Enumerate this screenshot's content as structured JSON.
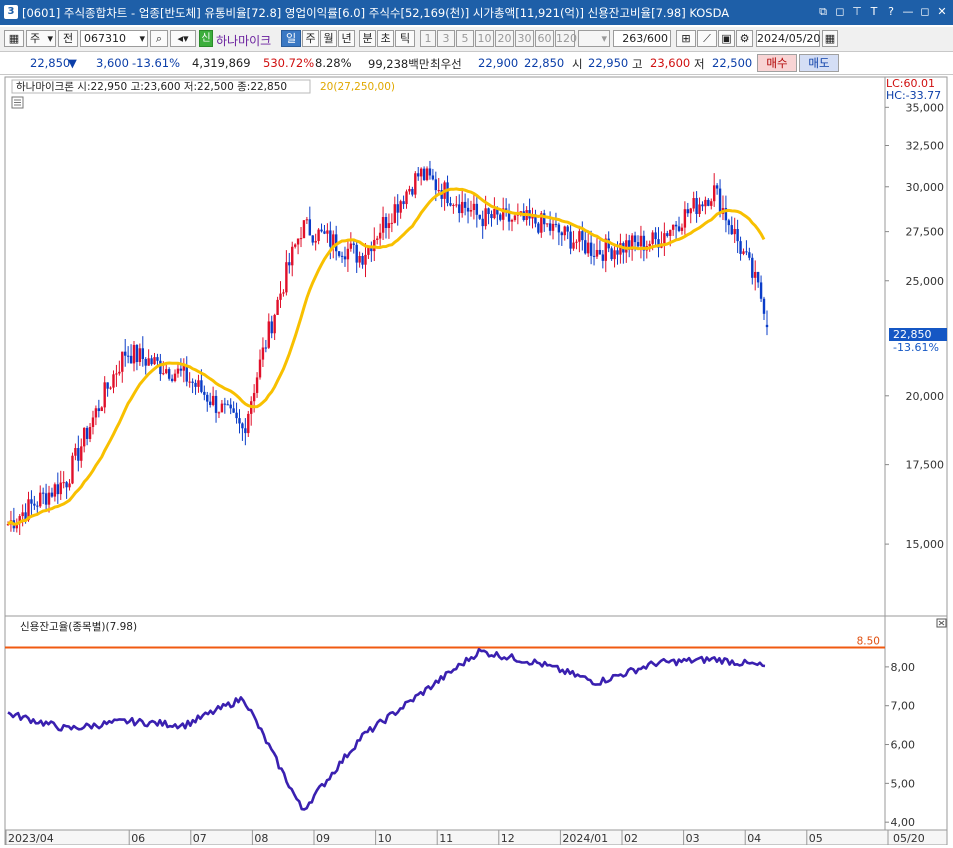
{
  "window": {
    "number": "3",
    "title": "[0601] 주식종합차트 - 업종[반도체] 유통비율[72.8] 영업이익률[6.0] 주식수[52,169(천)] 시가총액[11,921(억)] 신용잔고비율[7.98] KOSDA",
    "buttons": [
      "⧉",
      "◻",
      "⊤",
      "T",
      "?",
      "—",
      "◻",
      "✕"
    ]
  },
  "toolbar": {
    "period_select": "주",
    "jeon": "전",
    "code": "067310",
    "sin_badge": "신",
    "stock_name": "하나마이크",
    "periods": [
      "일",
      "주",
      "월",
      "년",
      "분",
      "초",
      "틱"
    ],
    "active_period": "일",
    "intervals": [
      "1",
      "3",
      "5",
      "10",
      "20",
      "30",
      "60",
      "120"
    ],
    "count": "263",
    "count_max": "/600",
    "date": "2024/05/20"
  },
  "quote": {
    "price": "22,850",
    "arrow": "▼",
    "change": "3,600",
    "change_pct": "-13.61%",
    "volume": "4,319,869",
    "vol_ratio": "530.72%",
    "turnover": "8.28%",
    "amount": "99,238백만",
    "best_label": "최우선",
    "ask": "22,900",
    "bid": "22,850",
    "open_label": "시",
    "open": "22,950",
    "high_label": "고",
    "high": "23,600",
    "low_label": "저",
    "low": "22,500",
    "buy_button": "매수",
    "sell_button": "매도"
  },
  "price_panel": {
    "legend": "하나마이크론 시:22,950 고:23,600 저:22,500 종:22,850",
    "ma_legend": "20(27,250,00)",
    "lc_label": "LC:60.01",
    "hc_label": "HC:-33.77",
    "last_price_tag": "22,850",
    "last_pct_tag": "-13.61%",
    "colors": {
      "up": "#e0102a",
      "down": "#0a3cc8",
      "ma": "#f8c000"
    }
  },
  "credit_panel": {
    "legend": "신용잔고율(종목별)(7.98)",
    "hline_label": "8.50",
    "hline_value": 8.5,
    "colors": {
      "line": "#3a20b0",
      "hline": "#f05a10"
    }
  },
  "chart_data": [
    {
      "type": "candlestick",
      "title": "하나마이크론 시:22,950 고:23,600 저:22,500 종:22,850",
      "x_ticks": [
        "2023/04",
        "06",
        "07",
        "08",
        "09",
        "10",
        "11",
        "12",
        "2024/01",
        "02",
        "03",
        "04",
        "05"
      ],
      "x_end_label": "05/20",
      "y_ticks": [
        15000,
        17500,
        20000,
        25000,
        27500,
        30000,
        32500,
        35000
      ],
      "y_tick_labels": [
        "15,000",
        "17,500",
        "20,000",
        "25,000",
        "27,500",
        "30,000",
        "32,500",
        "35,000"
      ],
      "ylim": [
        13200,
        35500
      ],
      "y_scale": "log",
      "bars_shown": 263,
      "monthly_closes": [
        {
          "month": "2023/04",
          "close": 15600
        },
        {
          "month": "2023/05",
          "close": 17000
        },
        {
          "month": "2023/06",
          "close": 21800
        },
        {
          "month": "2023/07",
          "close": 20800
        },
        {
          "month": "2023/08",
          "close": 18700
        },
        {
          "month": "2023/09",
          "close": 27800
        },
        {
          "month": "2023/10",
          "close": 26200
        },
        {
          "month": "2023/11",
          "close": 30800
        },
        {
          "month": "2023/12",
          "close": 28300
        },
        {
          "month": "2024/01",
          "close": 28000
        },
        {
          "month": "2024/02",
          "close": 26500
        },
        {
          "month": "2024/03",
          "close": 27000
        },
        {
          "month": "2024/04",
          "close": 29800
        },
        {
          "month": "2024/05",
          "close": 22850
        }
      ],
      "last_candle": {
        "open": 22950,
        "high": 23600,
        "low": 22500,
        "close": 22850
      },
      "moving_average": {
        "period": 20,
        "last": 27250
      }
    },
    {
      "type": "line",
      "title": "신용잔고율(종목별)(7.98)",
      "y_ticks": [
        4.0,
        5.0,
        6.0,
        7.0,
        8.0
      ],
      "y_tick_labels": [
        "4,00",
        "5,00",
        "6,00",
        "7,00",
        "8,00"
      ],
      "ylim": [
        3.85,
        8.95
      ],
      "reference_line": 8.5,
      "last": 7.98,
      "monthly_values": [
        {
          "month": "2023/04",
          "value": 6.8
        },
        {
          "month": "2023/05",
          "value": 6.4
        },
        {
          "month": "2023/06",
          "value": 6.6
        },
        {
          "month": "2023/07",
          "value": 6.5
        },
        {
          "month": "2023/08",
          "value": 7.2
        },
        {
          "month": "2023/09",
          "value": 4.3
        },
        {
          "month": "2023/10",
          "value": 6.2
        },
        {
          "month": "2023/11",
          "value": 7.3
        },
        {
          "month": "2023/12",
          "value": 8.4
        },
        {
          "month": "2024/01",
          "value": 8.1
        },
        {
          "month": "2024/02",
          "value": 7.6
        },
        {
          "month": "2024/03",
          "value": 8.1
        },
        {
          "month": "2024/04",
          "value": 8.2
        },
        {
          "month": "2024/05",
          "value": 7.98
        }
      ]
    }
  ]
}
